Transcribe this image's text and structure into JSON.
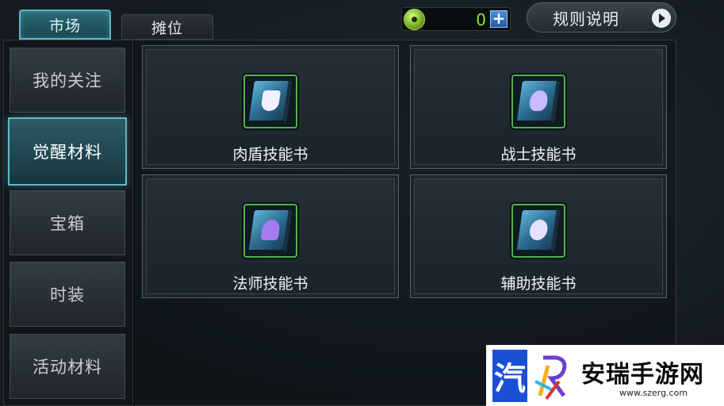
{
  "tabs": [
    {
      "label": "市场",
      "active": true
    },
    {
      "label": "摊位",
      "active": false
    }
  ],
  "currency": {
    "value": "0",
    "add_label": "+"
  },
  "rules_button": {
    "label": "规则说明"
  },
  "sidebar": {
    "items": [
      {
        "label": "我的关注",
        "active": false
      },
      {
        "label": "觉醒材料",
        "active": true
      },
      {
        "label": "宝箱",
        "active": false
      },
      {
        "label": "时装",
        "active": false
      },
      {
        "label": "活动材料",
        "active": false
      }
    ]
  },
  "items": [
    {
      "label": "肉盾技能书",
      "icon": "tank-skill-book-icon"
    },
    {
      "label": "战士技能书",
      "icon": "warrior-skill-book-icon"
    },
    {
      "label": "法师技能书",
      "icon": "mage-skill-book-icon"
    },
    {
      "label": "辅助技能书",
      "icon": "support-skill-book-icon"
    }
  ],
  "watermark": {
    "logo_char": "汽",
    "title": "安瑞手游网",
    "url": "www.szerg.com"
  },
  "colors": {
    "accent": "#63b9c8",
    "currency": "#8fe03e",
    "icon_border": "#4fb34a"
  }
}
